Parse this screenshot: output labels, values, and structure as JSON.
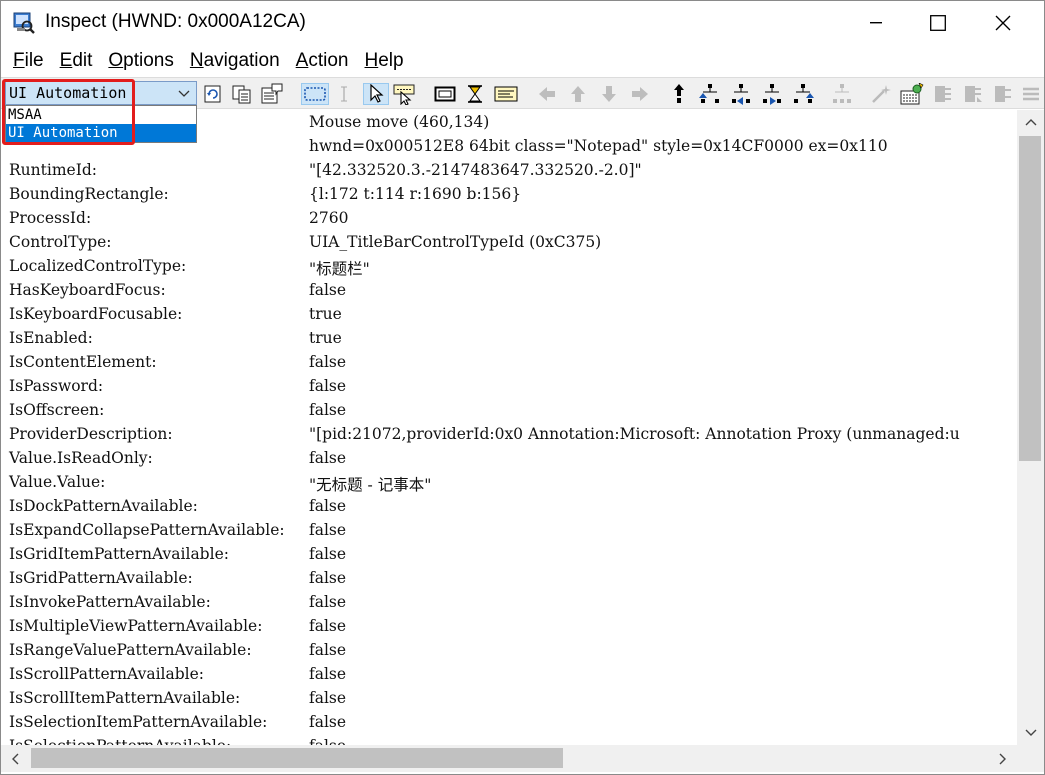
{
  "window": {
    "title": "Inspect  (HWND: 0x000A12CA)"
  },
  "menu": [
    {
      "label": "File",
      "mnemonic": "F",
      "rest": "ile"
    },
    {
      "label": "Edit",
      "mnemonic": "E",
      "rest": "dit"
    },
    {
      "label": "Options",
      "mnemonic": "O",
      "rest": "ptions"
    },
    {
      "label": "Navigation",
      "mnemonic": "N",
      "rest": "avigation"
    },
    {
      "label": "Action",
      "mnemonic": "A",
      "rest": "ction"
    },
    {
      "label": "Help",
      "mnemonic": "H",
      "rest": "elp"
    }
  ],
  "toolbar": {
    "mode_combo_value": "UI Automation",
    "mode_options": [
      "MSAA",
      "UI Automation"
    ],
    "selected_option": "UI Automation"
  },
  "properties": [
    {
      "key": "",
      "value": "Mouse move (460,134)"
    },
    {
      "key": "",
      "value": "hwnd=0x000512E8 64bit class=\"Notepad\" style=0x14CF0000 ex=0x110"
    },
    {
      "key": "RuntimeId:",
      "value": "\"[42.332520.3.-2147483647.332520.-2.0]\""
    },
    {
      "key": "BoundingRectangle:",
      "value": "{l:172 t:114 r:1690 b:156}"
    },
    {
      "key": "ProcessId:",
      "value": "2760"
    },
    {
      "key": "ControlType:",
      "value": "UIA_TitleBarControlTypeId (0xC375)"
    },
    {
      "key": "LocalizedControlType:",
      "value": "\"标题栏\""
    },
    {
      "key": "HasKeyboardFocus:",
      "value": "false"
    },
    {
      "key": "IsKeyboardFocusable:",
      "value": "true"
    },
    {
      "key": "IsEnabled:",
      "value": "true"
    },
    {
      "key": "IsContentElement:",
      "value": "false"
    },
    {
      "key": "IsPassword:",
      "value": "false"
    },
    {
      "key": "IsOffscreen:",
      "value": "false"
    },
    {
      "key": "ProviderDescription:",
      "value": "\"[pid:21072,providerId:0x0 Annotation:Microsoft: Annotation Proxy (unmanaged:u"
    },
    {
      "key": "Value.IsReadOnly:",
      "value": "false"
    },
    {
      "key": "Value.Value:",
      "value": "\"无标题 - 记事本\""
    },
    {
      "key": "IsDockPatternAvailable:",
      "value": "false"
    },
    {
      "key": "IsExpandCollapsePatternAvailable:",
      "value": "false"
    },
    {
      "key": "IsGridItemPatternAvailable:",
      "value": "false"
    },
    {
      "key": "IsGridPatternAvailable:",
      "value": "false"
    },
    {
      "key": "IsInvokePatternAvailable:",
      "value": "false"
    },
    {
      "key": "IsMultipleViewPatternAvailable:",
      "value": "false"
    },
    {
      "key": "IsRangeValuePatternAvailable:",
      "value": "false"
    },
    {
      "key": "IsScrollPatternAvailable:",
      "value": "false"
    },
    {
      "key": "IsScrollItemPatternAvailable:",
      "value": "false"
    },
    {
      "key": "IsSelectionItemPatternAvailable:",
      "value": "false"
    },
    {
      "key": "IsSelectionPatternAvailable:",
      "value": "false"
    }
  ],
  "icons": {
    "toolbar": [
      "refresh-icon",
      "copy-icon",
      "copy-properties-icon",
      "rectangle-select-icon",
      "text-cursor-icon",
      "pointer-icon",
      "focus-tracking-icon",
      "highlight-rectangle-icon",
      "caret-tracking-icon",
      "show-info-icon",
      "nav-left-icon",
      "nav-up-icon",
      "nav-down-icon",
      "nav-right-icon",
      "nav-parent-icon",
      "nav-first-child-icon",
      "nav-prev-sibling-icon",
      "nav-next-sibling-icon",
      "nav-last-child-icon",
      "tree-icon",
      "magic-icon",
      "settings-icon",
      "action-icon-1",
      "action-icon-2",
      "action-icon-3",
      "action-icon-4"
    ]
  },
  "colors": {
    "selection": "#0078d7",
    "combo_bg": "#cce4f7",
    "highlight": "#e21d1d"
  }
}
